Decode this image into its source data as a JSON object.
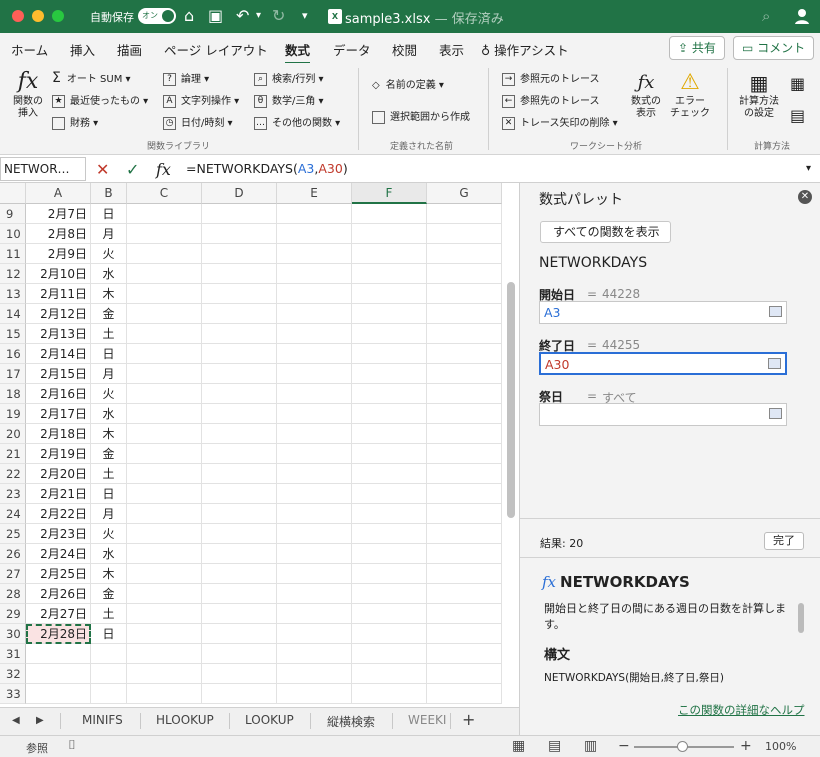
{
  "titlebar": {
    "autosave_label": "自動保存",
    "autosave_toggle": "オン",
    "file_name": "sample3.xlsx",
    "file_status": "— 保存済み"
  },
  "ribbon_tabs": [
    "ホーム",
    "挿入",
    "描画",
    "ページ レイアウト",
    "数式",
    "データ",
    "校閲",
    "表示",
    "操作アシスト"
  ],
  "active_tab": "数式",
  "share_label": "共有",
  "comment_label": "コメント",
  "ribbon": {
    "insert_function": "関数の\n挿入",
    "autosum": "オート SUM",
    "recent": "最近使ったもの",
    "financial": "財務",
    "logical": "論理",
    "text": "文字列操作",
    "datetime": "日付/時刻",
    "lookup": "検索/行列",
    "math": "数学/三角",
    "more": "その他の関数",
    "group_library": "関数ライブラリ",
    "define_name": "名前の定義",
    "create_from_selection": "選択範囲から作成",
    "group_names": "定義された名前",
    "trace_precedents": "参照元のトレース",
    "trace_dependents": "参照先のトレース",
    "remove_arrows": "トレース矢印の削除",
    "show_formulas": "数式の\n表示",
    "error_check": "エラー\nチェック",
    "group_audit": "ワークシート分析",
    "calc_options": "計算方法\nの設定",
    "group_calc": "計算方法"
  },
  "formula_bar": {
    "name_box": "NETWOR…",
    "formula_prefix": "=NETWORKDAYS(",
    "arg1": "A3",
    "comma": ",",
    "arg2": "A30",
    "suffix": ")"
  },
  "columns": [
    "A",
    "B",
    "C",
    "D",
    "E",
    "F",
    "G"
  ],
  "selected_column": "F",
  "rows": [
    {
      "n": "9",
      "a": "2月7日",
      "b": "日"
    },
    {
      "n": "10",
      "a": "2月8日",
      "b": "月"
    },
    {
      "n": "11",
      "a": "2月9日",
      "b": "火"
    },
    {
      "n": "12",
      "a": "2月10日",
      "b": "水"
    },
    {
      "n": "13",
      "a": "2月11日",
      "b": "木"
    },
    {
      "n": "14",
      "a": "2月12日",
      "b": "金"
    },
    {
      "n": "15",
      "a": "2月13日",
      "b": "土"
    },
    {
      "n": "16",
      "a": "2月14日",
      "b": "日"
    },
    {
      "n": "17",
      "a": "2月15日",
      "b": "月"
    },
    {
      "n": "18",
      "a": "2月16日",
      "b": "火"
    },
    {
      "n": "19",
      "a": "2月17日",
      "b": "水"
    },
    {
      "n": "20",
      "a": "2月18日",
      "b": "木"
    },
    {
      "n": "21",
      "a": "2月19日",
      "b": "金"
    },
    {
      "n": "22",
      "a": "2月20日",
      "b": "土"
    },
    {
      "n": "23",
      "a": "2月21日",
      "b": "日"
    },
    {
      "n": "24",
      "a": "2月22日",
      "b": "月"
    },
    {
      "n": "25",
      "a": "2月23日",
      "b": "火"
    },
    {
      "n": "26",
      "a": "2月24日",
      "b": "水"
    },
    {
      "n": "27",
      "a": "2月25日",
      "b": "木"
    },
    {
      "n": "28",
      "a": "2月26日",
      "b": "金"
    },
    {
      "n": "29",
      "a": "2月27日",
      "b": "土"
    },
    {
      "n": "30",
      "a": "2月28日",
      "b": "日"
    },
    {
      "n": "31",
      "a": "",
      "b": ""
    },
    {
      "n": "32",
      "a": "",
      "b": ""
    },
    {
      "n": "33",
      "a": "",
      "b": ""
    }
  ],
  "active_row": "30",
  "sheet_tabs": [
    "MINIFS",
    "HLOOKUP",
    "LOOKUP",
    "縦横検索",
    "WEEKI"
  ],
  "panel": {
    "title": "数式パレット",
    "back_label": "すべての関数を表示",
    "function_name": "NETWORKDAYS",
    "args": [
      {
        "label": "開始日",
        "eq": "=",
        "value": "44228",
        "input": "A3",
        "color": "blue"
      },
      {
        "label": "終了日",
        "eq": "=",
        "value": "44255",
        "input": "A30",
        "color": "red"
      },
      {
        "label": "祭日",
        "eq": "=",
        "value": "すべて",
        "input": "",
        "color": "none"
      }
    ],
    "result": "結果: 20",
    "done_label": "完了",
    "help_fx": "fx",
    "help_title": "NETWORKDAYS",
    "help_desc": "開始日と終了日の間にある週日の日数を計算します。",
    "syntax_heading": "構文",
    "syntax": "NETWORKDAYS(開始日,終了日,祭日)",
    "help_link": "この関数の詳細なヘルプ"
  },
  "status": {
    "mode": "参照",
    "zoom": "100%"
  }
}
